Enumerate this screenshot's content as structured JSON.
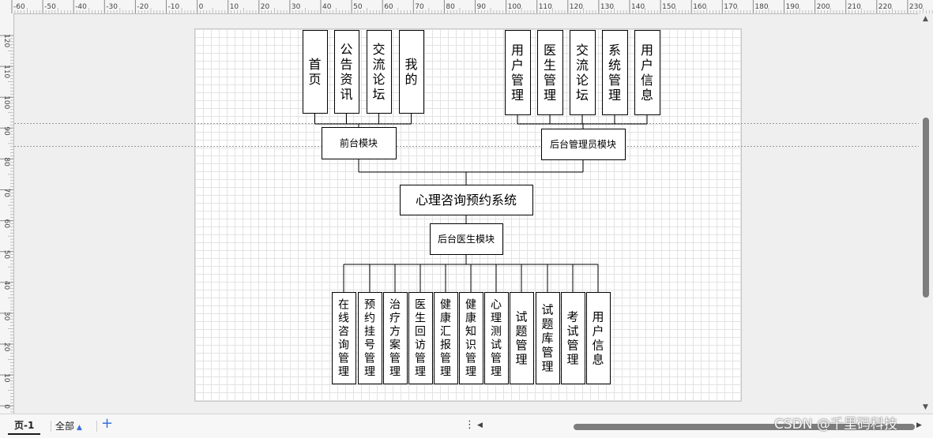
{
  "ruler": {
    "top_labels": [
      "-60",
      "-50",
      "-40",
      "-30",
      "-20",
      "-10",
      "0",
      "10",
      "20",
      "30",
      "40",
      "50",
      "60",
      "70",
      "80",
      "90",
      "100",
      "110",
      "120",
      "130",
      "140",
      "150",
      "160",
      "170",
      "180",
      "190",
      "200",
      "210",
      "220",
      "230"
    ],
    "left_labels": [
      "120",
      "110",
      "100",
      "90",
      "80",
      "70",
      "60",
      "50",
      "40",
      "30",
      "20",
      "10",
      "0"
    ]
  },
  "diagram": {
    "root": "心理咨询预约系统",
    "front": {
      "label": "前台模块",
      "children": [
        "首页",
        "公告资讯",
        "交流论坛",
        "我的"
      ]
    },
    "admin": {
      "label": "后台管理员模块",
      "children": [
        "用户管理",
        "医生管理",
        "交流论坛",
        "系统管理",
        "用户信息"
      ]
    },
    "doctor": {
      "label": "后台医生模块",
      "children": [
        "在线咨询管理",
        "预约挂号管理",
        "治疗方案管理",
        "医生回访管理",
        "健康汇报管理",
        "健康知识管理",
        "心理测试管理",
        "试题管理",
        "试题库管理",
        "考试管理",
        "用户信息"
      ]
    }
  },
  "bottom": {
    "page_tab": "页-1",
    "all_tab": "全部",
    "add_icon": "plus-icon",
    "watermark": "CSDN @千里码科技"
  }
}
